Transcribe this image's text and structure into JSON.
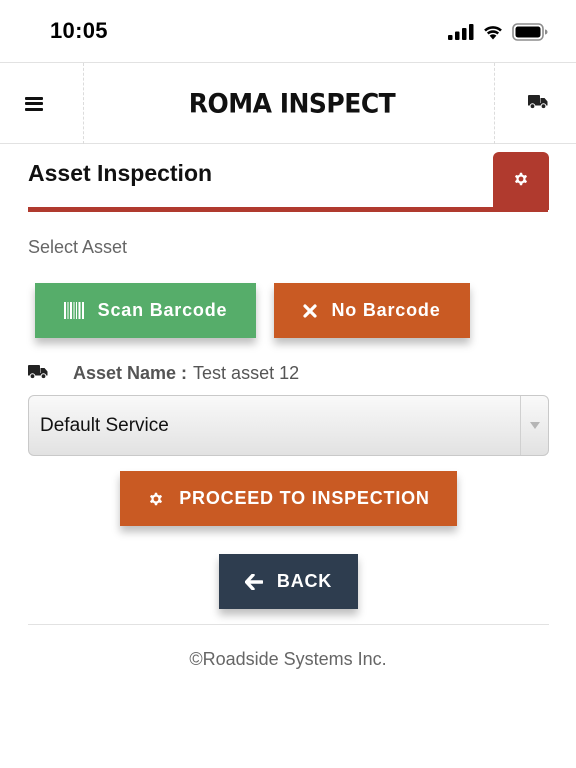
{
  "status_bar": {
    "time": "10:05",
    "icons": [
      "cellular-signal-icon",
      "wifi-icon",
      "battery-icon"
    ]
  },
  "header": {
    "menu_icon": "hamburger-menu-icon",
    "logo_text": "ROMA INSPECT",
    "truck_icon": "truck-icon"
  },
  "page": {
    "title": "Asset Inspection",
    "settings_icon": "gear-icon",
    "section_label": "Select Asset"
  },
  "buttons": {
    "scan_label": "Scan Barcode",
    "no_barcode_label": "No Barcode",
    "proceed_label": "PROCEED TO INSPECTION",
    "back_label": "BACK"
  },
  "asset": {
    "label": "Asset Name :",
    "value": "Test asset 12"
  },
  "service_select": {
    "selected": "Default Service"
  },
  "footer": {
    "copyright": "©Roadside Systems Inc."
  },
  "colors": {
    "accent_red": "#b03a2e",
    "scan_green": "#56ad6a",
    "action_orange": "#c95a23",
    "back_navy": "#2e3d4f"
  }
}
